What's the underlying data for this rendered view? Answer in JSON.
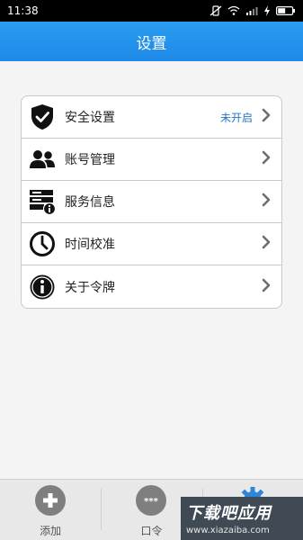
{
  "status_bar": {
    "time": "11:38"
  },
  "header": {
    "title": "设置"
  },
  "menu": {
    "items": [
      {
        "label": "安全设置",
        "value": "未开启",
        "icon": "shield-check-icon"
      },
      {
        "label": "账号管理",
        "value": "",
        "icon": "users-icon"
      },
      {
        "label": "服务信息",
        "value": "",
        "icon": "server-info-icon"
      },
      {
        "label": "时间校准",
        "value": "",
        "icon": "clock-icon"
      },
      {
        "label": "关于令牌",
        "value": "",
        "icon": "info-icon"
      }
    ]
  },
  "tab_bar": {
    "tabs": [
      {
        "label": "添加",
        "icon": "plus-icon"
      },
      {
        "label": "口令",
        "icon": "password-dots-icon"
      },
      {
        "label": "",
        "icon": "gear-icon"
      }
    ]
  },
  "watermark": {
    "title": "下载吧应用",
    "url": "www.xiazaiba.com"
  },
  "colors": {
    "header": "#1e8ae8",
    "accent": "#2777c9"
  }
}
